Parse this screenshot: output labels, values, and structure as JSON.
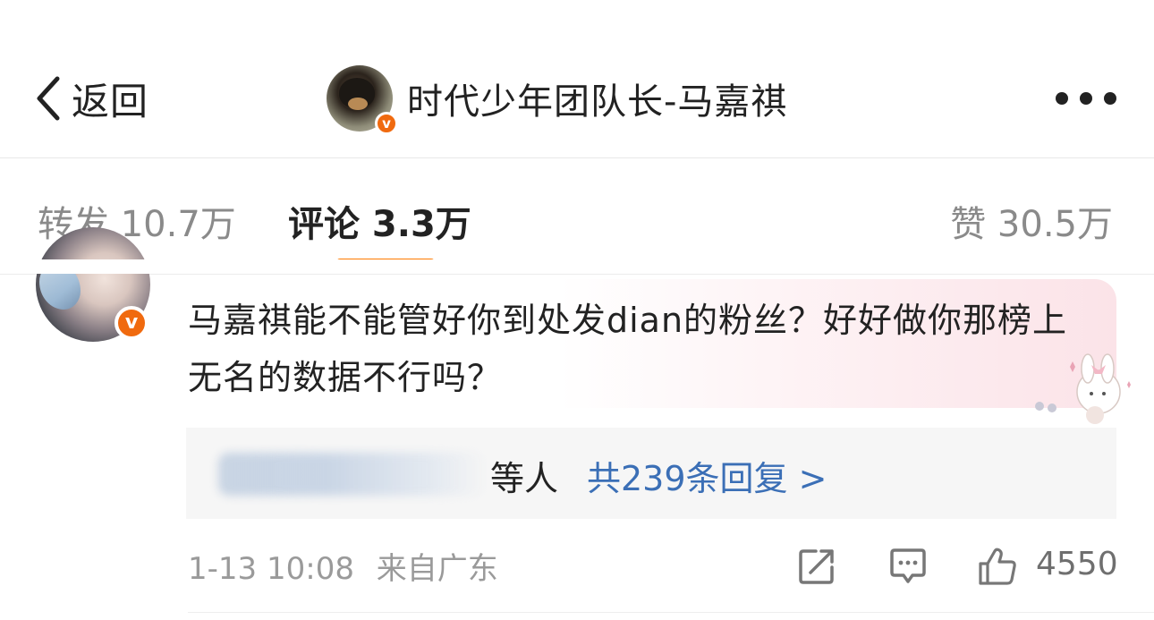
{
  "header": {
    "back_label": "返回",
    "title": "时代少年团队长-马嘉祺",
    "verified_badge": "v"
  },
  "tabs": [
    {
      "label": "转发 10.7万"
    },
    {
      "label": "评论 3.3万",
      "active": true
    },
    {
      "label": "赞 30.5万"
    }
  ],
  "comment": {
    "verified_badge": "v",
    "text": "马嘉祺能不能管好你到处发dian的粉丝？好好做你那榜上无名的数据不行吗？",
    "replies_suffix": "等人",
    "replies_count_label": "共239条回复 >",
    "time": "1-13 10:08",
    "location": "来自广东",
    "likes": "4550"
  },
  "colors": {
    "accent": "#ff7a00",
    "link": "#3b6fb6",
    "verified": "#f06a0f",
    "muted": "#9a9a9a"
  },
  "icons": [
    "back-arrow-icon",
    "more-icon",
    "share-icon",
    "comment-icon",
    "like-icon"
  ]
}
